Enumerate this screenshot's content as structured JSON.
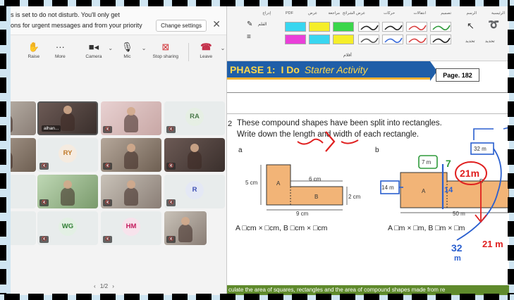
{
  "notification": {
    "line1": "is is set to do not disturb. You'll only get",
    "line2": "ions for urgent messages and from your priority",
    "button": "Change settings"
  },
  "toolbar": {
    "raise": "Raise",
    "more": "More",
    "camera": "Camera",
    "mic": "Mic",
    "share": "Stop sharing",
    "leave": "Leave"
  },
  "participants": [
    {
      "name": "alhan..."
    },
    {
      "initials": "RA"
    },
    {
      "initials": "RY"
    },
    {
      "initials": "R"
    },
    {
      "initials": "WG"
    },
    {
      "initials": "HM"
    }
  ],
  "pager": {
    "prev": "‹",
    "label": "1/2",
    "next": "›"
  },
  "ribbon": {
    "tabs": [
      "الرئيسية",
      "الرسم",
      "تصميم",
      "انتقالات",
      "حركات",
      "عرض الشرائح",
      "مراجعة",
      "عرض",
      "PDF",
      "إدراج"
    ],
    "group_label": "أقلام",
    "side_labels": [
      "تحديد",
      "تحديد",
      "القلم"
    ],
    "swatch_colors": [
      "#39d6f0",
      "#f5ee2a",
      "#3bd64b",
      "#ea3fd9",
      "#39d6f0",
      "#f5ee2a"
    ],
    "pen_colors": [
      "#222222",
      "#222222",
      "#d94040",
      "#2e9a3a",
      "#555555",
      "#3a6ad9",
      "#d94040",
      "#222222"
    ]
  },
  "slide": {
    "phase_label": "PHASE 1:",
    "phase_title": "I Do",
    "phase_italic": "Starter  Activity",
    "page": "Page. 182",
    "question_number": "2",
    "question_line1": "These compound shapes have been split into rectangles.",
    "question_line2": "Write down the length and width of each rectangle.",
    "part_a": "a",
    "part_b": "b",
    "shape_a": {
      "top": "6 cm",
      "left": "5 cm",
      "right": "2 cm",
      "bottom": "9 cm",
      "label_a": "A",
      "label_b": "B"
    },
    "shape_b": {
      "top": "7 m",
      "left": "14 m",
      "right_top": "32 m",
      "bottom": "50 m",
      "label_a": "A",
      "label_b": "B"
    },
    "answer_a": "A □cm × □cm, B □cm × □cm",
    "answer_b": "A □m × □m, B □m × □m",
    "footer": "culate the area of squares, rectangles and the area of compound shapes made from re"
  },
  "annotations": {
    "seven": "7",
    "fourteen": "14",
    "twenty_one": "21m",
    "thirty_two": "32",
    "thirty_two_unit": "m",
    "twenty_one_bottom": "21 m"
  }
}
